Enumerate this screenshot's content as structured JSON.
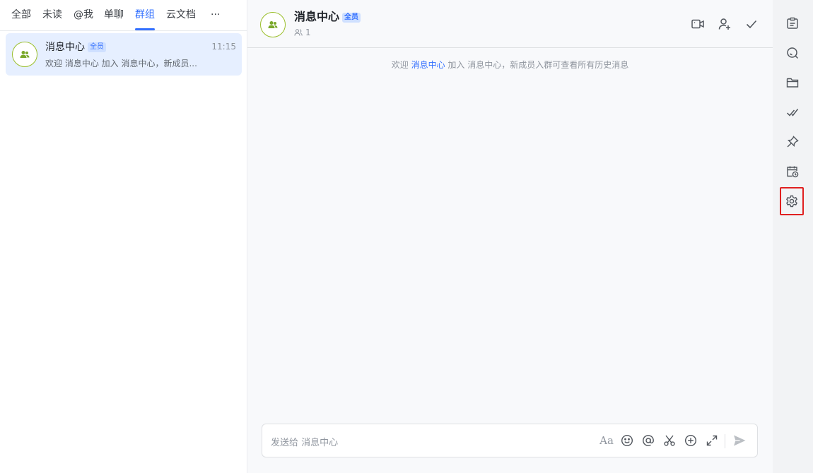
{
  "tabs": [
    {
      "label": "全部",
      "active": false
    },
    {
      "label": "未读",
      "active": false
    },
    {
      "label": "@我",
      "active": false
    },
    {
      "label": "单聊",
      "active": false
    },
    {
      "label": "群组",
      "active": true
    },
    {
      "label": "云文档",
      "active": false
    },
    {
      "label": "···",
      "active": false
    }
  ],
  "conversation": {
    "name": "消息中心",
    "badge": "全员",
    "time": "11:15",
    "preview": "欢迎 消息中心 加入 消息中心，新成员..."
  },
  "chat": {
    "title": "消息中心",
    "badge": "全员",
    "member_count": "1",
    "system_message": {
      "prefix": "欢迎",
      "link": "消息中心",
      "suffix": "加入 消息中心，新成员入群可查看所有历史消息"
    }
  },
  "header_actions": [
    "video-call-icon",
    "add-member-icon",
    "check-icon"
  ],
  "input": {
    "placeholder": "发送给 消息中心",
    "format_label": "Aa",
    "tools": [
      "emoji-icon",
      "mention-icon",
      "scissors-icon",
      "plus-circle-icon",
      "expand-icon",
      "send-icon"
    ]
  },
  "rail": [
    "announcement-icon",
    "search-icon",
    "folder-icon",
    "task-icon",
    "pin-icon",
    "calendar-icon",
    "settings-icon"
  ],
  "colors": {
    "accent": "#3370ff",
    "avatar_ring": "#9bbf2c",
    "highlight": "#e02020"
  }
}
